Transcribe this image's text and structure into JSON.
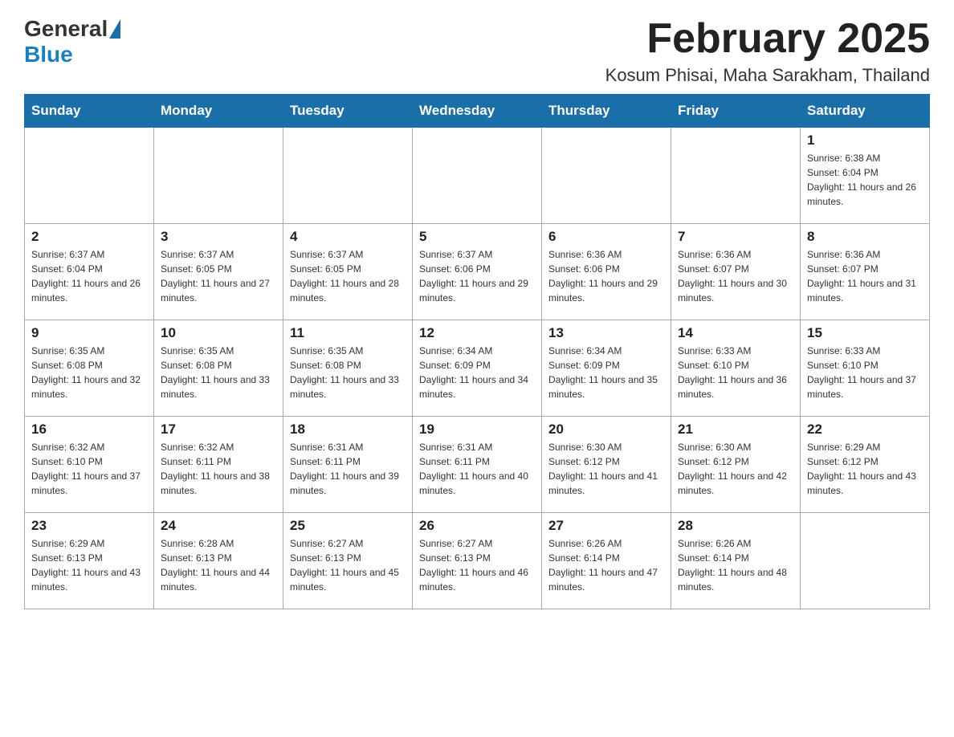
{
  "header": {
    "logo": {
      "general": "General",
      "blue": "Blue"
    },
    "title": "February 2025",
    "location": "Kosum Phisai, Maha Sarakham, Thailand"
  },
  "days_of_week": [
    "Sunday",
    "Monday",
    "Tuesday",
    "Wednesday",
    "Thursday",
    "Friday",
    "Saturday"
  ],
  "weeks": [
    [
      {
        "day": "",
        "sunrise": "",
        "sunset": "",
        "daylight": ""
      },
      {
        "day": "",
        "sunrise": "",
        "sunset": "",
        "daylight": ""
      },
      {
        "day": "",
        "sunrise": "",
        "sunset": "",
        "daylight": ""
      },
      {
        "day": "",
        "sunrise": "",
        "sunset": "",
        "daylight": ""
      },
      {
        "day": "",
        "sunrise": "",
        "sunset": "",
        "daylight": ""
      },
      {
        "day": "",
        "sunrise": "",
        "sunset": "",
        "daylight": ""
      },
      {
        "day": "1",
        "sunrise": "Sunrise: 6:38 AM",
        "sunset": "Sunset: 6:04 PM",
        "daylight": "Daylight: 11 hours and 26 minutes."
      }
    ],
    [
      {
        "day": "2",
        "sunrise": "Sunrise: 6:37 AM",
        "sunset": "Sunset: 6:04 PM",
        "daylight": "Daylight: 11 hours and 26 minutes."
      },
      {
        "day": "3",
        "sunrise": "Sunrise: 6:37 AM",
        "sunset": "Sunset: 6:05 PM",
        "daylight": "Daylight: 11 hours and 27 minutes."
      },
      {
        "day": "4",
        "sunrise": "Sunrise: 6:37 AM",
        "sunset": "Sunset: 6:05 PM",
        "daylight": "Daylight: 11 hours and 28 minutes."
      },
      {
        "day": "5",
        "sunrise": "Sunrise: 6:37 AM",
        "sunset": "Sunset: 6:06 PM",
        "daylight": "Daylight: 11 hours and 29 minutes."
      },
      {
        "day": "6",
        "sunrise": "Sunrise: 6:36 AM",
        "sunset": "Sunset: 6:06 PM",
        "daylight": "Daylight: 11 hours and 29 minutes."
      },
      {
        "day": "7",
        "sunrise": "Sunrise: 6:36 AM",
        "sunset": "Sunset: 6:07 PM",
        "daylight": "Daylight: 11 hours and 30 minutes."
      },
      {
        "day": "8",
        "sunrise": "Sunrise: 6:36 AM",
        "sunset": "Sunset: 6:07 PM",
        "daylight": "Daylight: 11 hours and 31 minutes."
      }
    ],
    [
      {
        "day": "9",
        "sunrise": "Sunrise: 6:35 AM",
        "sunset": "Sunset: 6:08 PM",
        "daylight": "Daylight: 11 hours and 32 minutes."
      },
      {
        "day": "10",
        "sunrise": "Sunrise: 6:35 AM",
        "sunset": "Sunset: 6:08 PM",
        "daylight": "Daylight: 11 hours and 33 minutes."
      },
      {
        "day": "11",
        "sunrise": "Sunrise: 6:35 AM",
        "sunset": "Sunset: 6:08 PM",
        "daylight": "Daylight: 11 hours and 33 minutes."
      },
      {
        "day": "12",
        "sunrise": "Sunrise: 6:34 AM",
        "sunset": "Sunset: 6:09 PM",
        "daylight": "Daylight: 11 hours and 34 minutes."
      },
      {
        "day": "13",
        "sunrise": "Sunrise: 6:34 AM",
        "sunset": "Sunset: 6:09 PM",
        "daylight": "Daylight: 11 hours and 35 minutes."
      },
      {
        "day": "14",
        "sunrise": "Sunrise: 6:33 AM",
        "sunset": "Sunset: 6:10 PM",
        "daylight": "Daylight: 11 hours and 36 minutes."
      },
      {
        "day": "15",
        "sunrise": "Sunrise: 6:33 AM",
        "sunset": "Sunset: 6:10 PM",
        "daylight": "Daylight: 11 hours and 37 minutes."
      }
    ],
    [
      {
        "day": "16",
        "sunrise": "Sunrise: 6:32 AM",
        "sunset": "Sunset: 6:10 PM",
        "daylight": "Daylight: 11 hours and 37 minutes."
      },
      {
        "day": "17",
        "sunrise": "Sunrise: 6:32 AM",
        "sunset": "Sunset: 6:11 PM",
        "daylight": "Daylight: 11 hours and 38 minutes."
      },
      {
        "day": "18",
        "sunrise": "Sunrise: 6:31 AM",
        "sunset": "Sunset: 6:11 PM",
        "daylight": "Daylight: 11 hours and 39 minutes."
      },
      {
        "day": "19",
        "sunrise": "Sunrise: 6:31 AM",
        "sunset": "Sunset: 6:11 PM",
        "daylight": "Daylight: 11 hours and 40 minutes."
      },
      {
        "day": "20",
        "sunrise": "Sunrise: 6:30 AM",
        "sunset": "Sunset: 6:12 PM",
        "daylight": "Daylight: 11 hours and 41 minutes."
      },
      {
        "day": "21",
        "sunrise": "Sunrise: 6:30 AM",
        "sunset": "Sunset: 6:12 PM",
        "daylight": "Daylight: 11 hours and 42 minutes."
      },
      {
        "day": "22",
        "sunrise": "Sunrise: 6:29 AM",
        "sunset": "Sunset: 6:12 PM",
        "daylight": "Daylight: 11 hours and 43 minutes."
      }
    ],
    [
      {
        "day": "23",
        "sunrise": "Sunrise: 6:29 AM",
        "sunset": "Sunset: 6:13 PM",
        "daylight": "Daylight: 11 hours and 43 minutes."
      },
      {
        "day": "24",
        "sunrise": "Sunrise: 6:28 AM",
        "sunset": "Sunset: 6:13 PM",
        "daylight": "Daylight: 11 hours and 44 minutes."
      },
      {
        "day": "25",
        "sunrise": "Sunrise: 6:27 AM",
        "sunset": "Sunset: 6:13 PM",
        "daylight": "Daylight: 11 hours and 45 minutes."
      },
      {
        "day": "26",
        "sunrise": "Sunrise: 6:27 AM",
        "sunset": "Sunset: 6:13 PM",
        "daylight": "Daylight: 11 hours and 46 minutes."
      },
      {
        "day": "27",
        "sunrise": "Sunrise: 6:26 AM",
        "sunset": "Sunset: 6:14 PM",
        "daylight": "Daylight: 11 hours and 47 minutes."
      },
      {
        "day": "28",
        "sunrise": "Sunrise: 6:26 AM",
        "sunset": "Sunset: 6:14 PM",
        "daylight": "Daylight: 11 hours and 48 minutes."
      },
      {
        "day": "",
        "sunrise": "",
        "sunset": "",
        "daylight": ""
      }
    ]
  ]
}
